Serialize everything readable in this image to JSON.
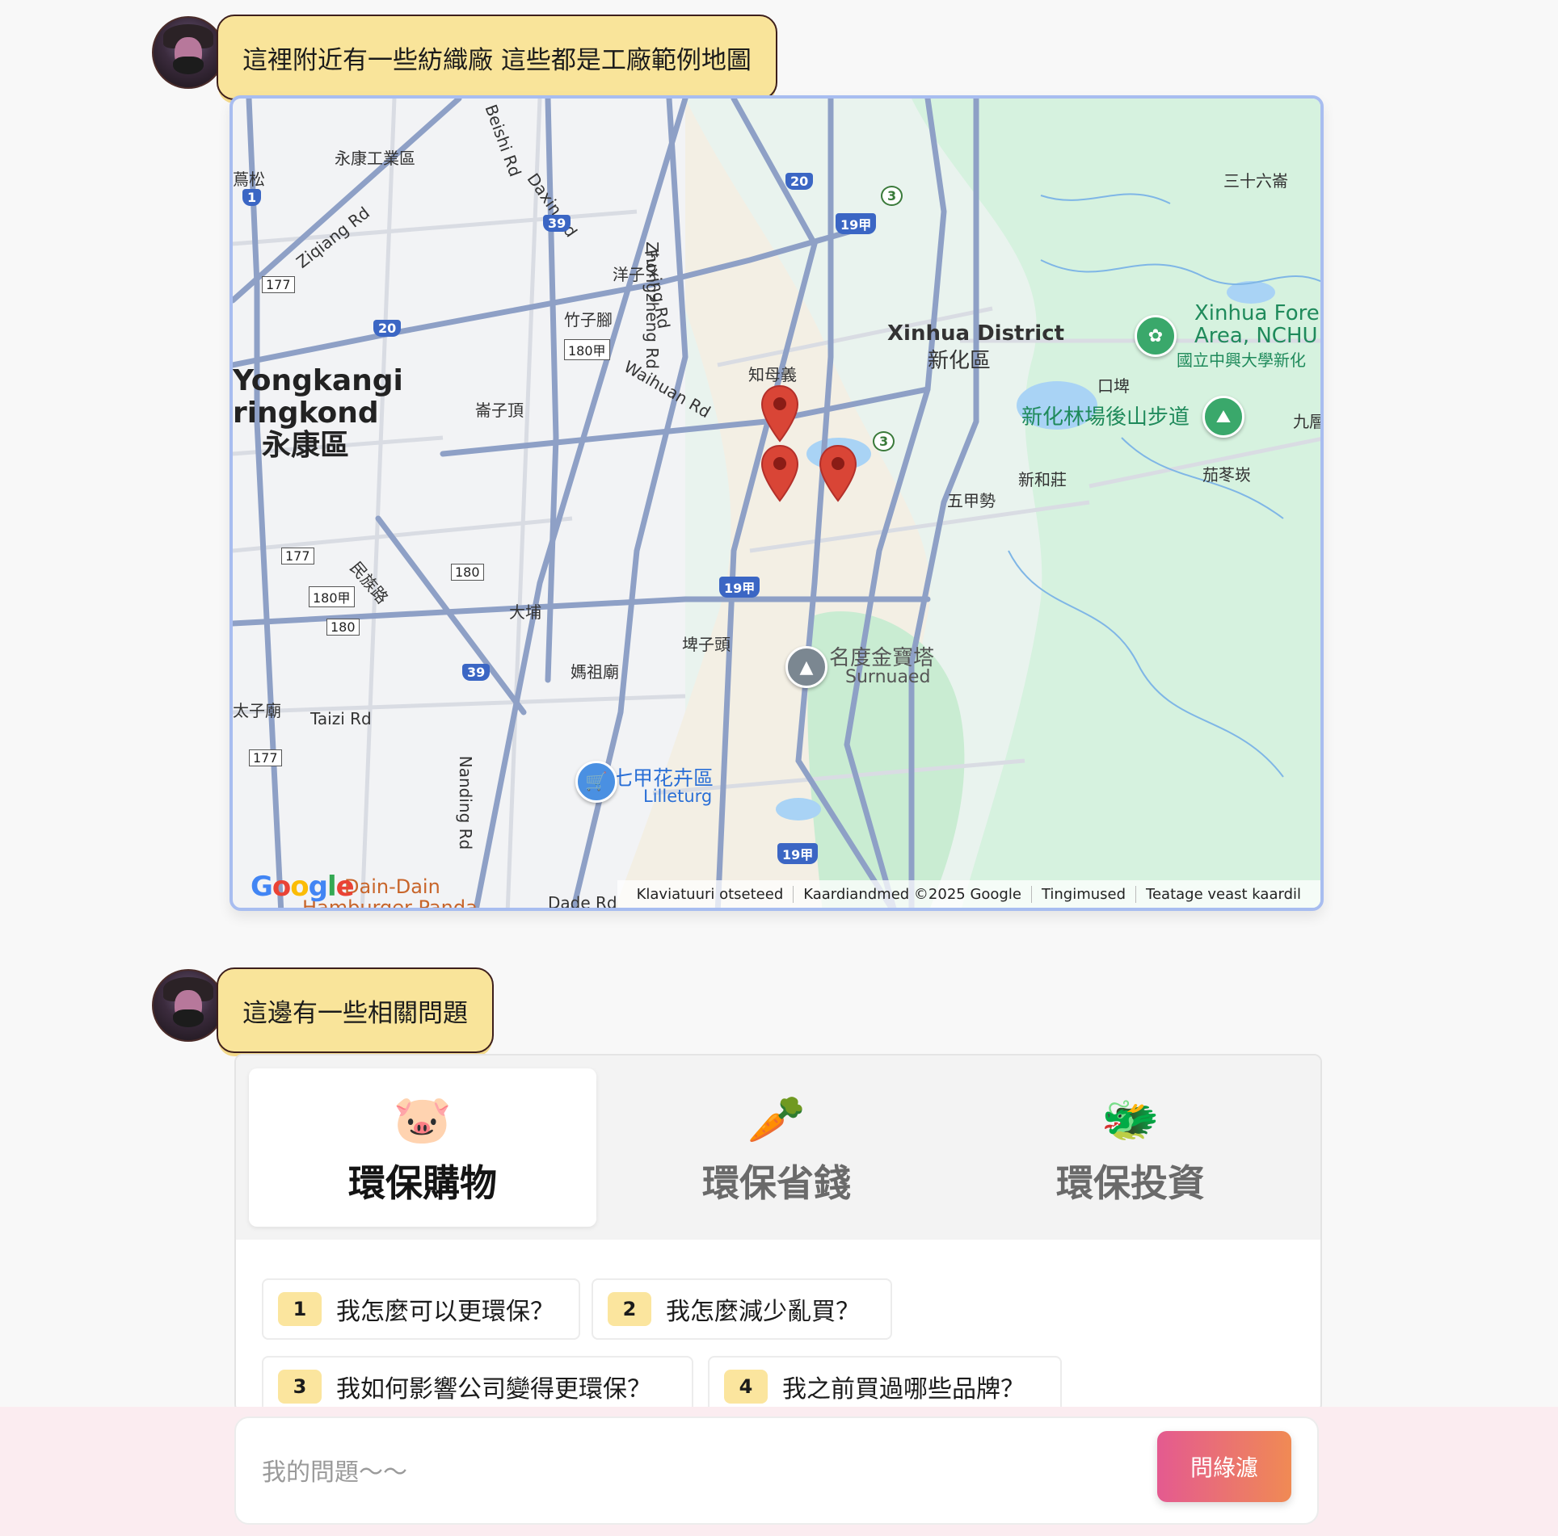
{
  "messages": [
    {
      "text": "這裡附近有一些紡織廠 這些都是工廠範例地圖"
    },
    {
      "text": "這邊有一些相關問題"
    }
  ],
  "map": {
    "labels": {
      "yongkang_industrial": "永康工業區",
      "wansong": "蔦松",
      "ziqiang_rd": "Ziqiang Rd",
      "beishi_rd": "Beishi Rd",
      "daxin_rd": "Daxin Rd",
      "yangzi": "洋子",
      "zhuzijiao": "竹子腳",
      "zhongzheng_rd": "Zhongzheng Rd",
      "fuxing_rd": "Fuxing Rd",
      "waihuan_rd": "Waihuan Rd",
      "zhimuyi": "知母義",
      "lunziding": "崙子頂",
      "yongkang_district": "Yongkangi\nringkond\n永康區",
      "xinhua_district": "Xinhua District",
      "xinhua_district_zh": "新化區",
      "sanshiliu": "三十六崙",
      "xinhua_forest": "Xinhua Fores\nArea, NCHU",
      "xinhua_forest_zh": "國立中興大學新化",
      "koupi": "口埤",
      "forest_trail": "新化林場後山步道",
      "jiuceng": "九層",
      "qielingkeng": "茄苳崁",
      "xinhezhuang": "新和莊",
      "wujiashi": "五甲勢",
      "minzu_rd": "民族路",
      "dapu": "大埔",
      "bizitou": "埤子頭",
      "mazumiao": "媽祖廟",
      "mingdu_pagoda": "名度金寶塔",
      "mingdu_pagoda_sub": "Surnuaed",
      "taizi_temple": "太子廟",
      "taizi_rd": "Taizi Rd",
      "nanding_rd": "Nanding Rd",
      "qijia_flower": "七甲花卉區",
      "qijia_flower_sub": "Lilleturg",
      "dade_rd": "Dade Rd",
      "dain_dain": "Dain-Dain",
      "hamburger_panda": "Hamburger Panda"
    },
    "shields": {
      "r1": "1",
      "r20a": "20",
      "r20b": "20",
      "r39a": "39",
      "r39b": "39",
      "r19a": "19甲",
      "r19b": "19甲",
      "r19c": "19甲",
      "r3a": "3",
      "r3b": "3",
      "b177a": "177",
      "b177b": "177",
      "b177c": "177",
      "b180jia_a": "180甲",
      "b180jia_b": "180甲",
      "b180a": "180",
      "b180b": "180"
    },
    "google": "Google",
    "attribution": [
      "Klaviatuuri otseteed",
      "Kaardiandmed ©2025 Google",
      "Tingimused",
      "Teatage veast kaardil"
    ],
    "pin_color": "#d94536"
  },
  "tabs": [
    {
      "label": "環保購物",
      "icon": "🐷"
    },
    {
      "label": "環保省錢",
      "icon": "🥕"
    },
    {
      "label": "環保投資",
      "icon": "🐲"
    }
  ],
  "questions": [
    {
      "num": "1",
      "text": "我怎麼可以更環保？"
    },
    {
      "num": "2",
      "text": "我怎麼減少亂買？"
    },
    {
      "num": "3",
      "text": "我如何影響公司變得更環保？"
    },
    {
      "num": "4",
      "text": "我之前買過哪些品牌？"
    }
  ],
  "input": {
    "placeholder": "我的問題～～",
    "value": ""
  },
  "send_button": "問綠濾",
  "colors": {
    "bubble": "#f9e49a",
    "accent_start": "#e45a90",
    "accent_end": "#f08a54",
    "map_border": "#a8bdf0"
  }
}
